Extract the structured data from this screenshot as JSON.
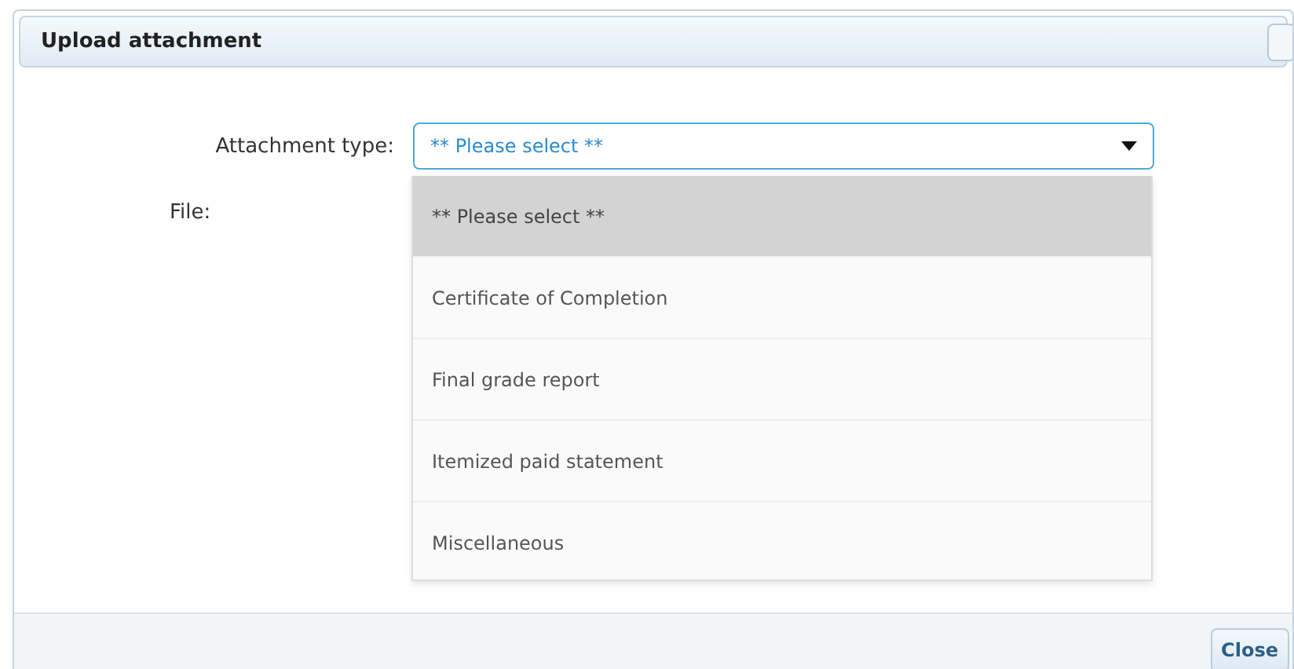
{
  "dialog": {
    "title": "Upload attachment"
  },
  "form": {
    "attachment_type": {
      "label": "Attachment type:",
      "value": "** Please select **",
      "expanded": true,
      "options": [
        {
          "label": "** Please select **",
          "selected": true
        },
        {
          "label": "Certificate of Completion",
          "selected": false
        },
        {
          "label": "Final grade report",
          "selected": false
        },
        {
          "label": "Itemized paid statement",
          "selected": false
        },
        {
          "label": "Miscellaneous",
          "selected": false
        }
      ]
    },
    "file": {
      "label": "File:"
    }
  },
  "buttons": [
    "Close"
  ]
}
